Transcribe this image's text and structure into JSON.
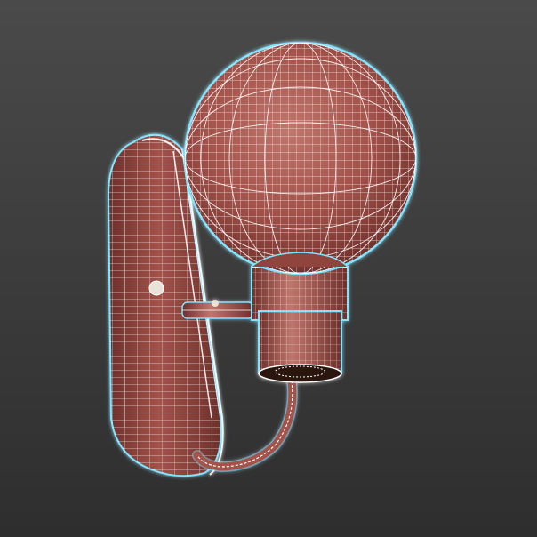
{
  "viewport": {
    "background_top": "#4a4a4a",
    "background_bottom": "#2e2e2e"
  },
  "model": {
    "subject": "wall-sconce-lamp",
    "shading": "wireframe-on-shaded",
    "surface_color": "#a3524a",
    "surface_highlight": "#c0766c",
    "surface_shadow": "#6e2f2a",
    "wire_color": "#ffffff",
    "selection_glow": "#7fe4ff"
  }
}
